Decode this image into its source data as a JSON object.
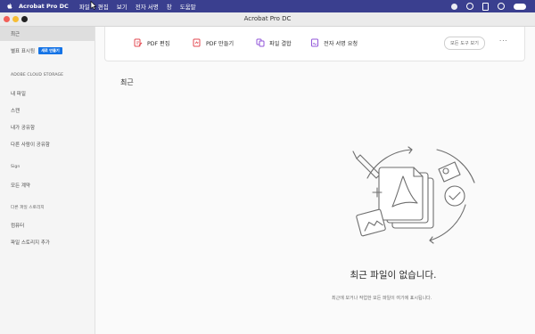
{
  "menubar": {
    "app_name": "Acrobat Pro DC",
    "items": [
      "파일",
      "편집",
      "보기",
      "전자 서명",
      "창",
      "도움말"
    ]
  },
  "window": {
    "title": "Acrobat Pro DC"
  },
  "sidebar": {
    "recent": "최근",
    "starred": "별표 표시됨",
    "new_badge": "새로 만들기",
    "storage_heading": "ADOBE CLOUD STORAGE",
    "my_files": "내 파일",
    "scans": "스캔",
    "shared_by_you": "내가 공유함",
    "shared_by_others": "다른 사람이 공유함",
    "sign_heading": "Sign",
    "all_agreements": "모든 계약",
    "other_storage_heading": "다른 파일 스토리지",
    "computer": "컴퓨터",
    "add_storage": "파일 스토리지 추가"
  },
  "toolbar": {
    "edit_pdf": "PDF 편집",
    "create_pdf": "PDF 만들기",
    "combine_files": "파일 결합",
    "request_esign": "전자 서명 요청",
    "all_tools": "모든 도구 보기",
    "more": "···"
  },
  "main": {
    "heading": "최근",
    "empty_title": "최근 파일이 없습니다.",
    "empty_subtitle": "최근에 보거나 작업한 모든 파일이 여기에 표시됩니다."
  },
  "colors": {
    "menubar": "#3a3f8f",
    "accent_blue": "#1473e6",
    "tool_red": "#e34850",
    "tool_purple": "#9256d9"
  }
}
